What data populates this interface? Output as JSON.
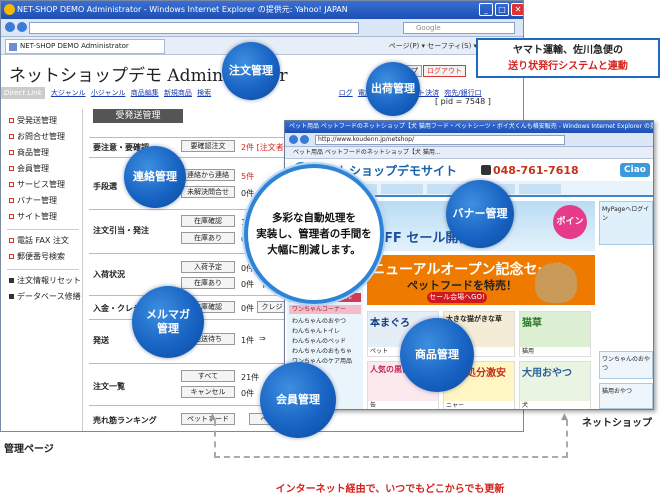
{
  "admin_window": {
    "title": "NET-SHOP DEMO Administrator - Windows Internet Explorer の提供元: Yahoo! JAPAN",
    "search_placeholder": "Google",
    "tab_label": "NET-SHOP DEMO Administrator",
    "command_bar": "ページ(P) ▾  セーフティ(S) ▾  ツール(O) ▾",
    "min": "_",
    "max": "□",
    "close": "✕",
    "site_title": "ネットショップデモ Administrator",
    "head_buttons": [
      "トップ",
      "ログアウト"
    ],
    "direct_link": "Direct Link",
    "nav_links": [
      "大ジャンル",
      "小ジャンル",
      "商品編集",
      "新規商品",
      "検索"
    ],
    "nav_links_right": [
      "ログ",
      "電話FAX受付",
      "ネット決済",
      "宛先/銀行口"
    ],
    "pid": "[ pid = 7548 ]",
    "sidebar": [
      "受発送管理",
      "お問合せ管理",
      "商品管理",
      "会員管理",
      "サービス管理",
      "バナー管理",
      "サイト管理",
      "電話 FAX 注文",
      "郵便番号検索",
      "注文情報リセット",
      "データベース修繕"
    ],
    "content_header": "受発送管理",
    "rows": {
      "r1_label": "要注意・要確認",
      "r1_btn": "要確認注文",
      "r1_count": "2件 [注文者",
      "r2_label": "手段選",
      "r2_btn1": "連絡から連絡",
      "r2_count": "5件",
      "r2_btn2": "未解決問合せ",
      "r2_count2": "0件",
      "r3_label": "注文引当・発注",
      "r3_btn1": "在庫確認",
      "r3_count1": "1 件",
      "r3_btn2": "在庫あり",
      "r3_count2": "0件",
      "r4_label": "入荷状況",
      "r4_btn1": "入荷予定",
      "r4_count1": "0件",
      "r4_btn2": "在庫あり",
      "r4_count2": "0件　商品 1",
      "r5_label": "入金・クレジット",
      "r5_btn1": "在庫確認",
      "r5_count1": "0件",
      "r5_btn3": "クレジ",
      "r6_label": "発送",
      "r6_btn": "発送待ち",
      "r6_count": "1件",
      "r6_arrow": "⇒",
      "r7_label": "注文一覧",
      "r7_btn1": "すべて",
      "r7_count1": "21件",
      "r7_btn2": "キャンセル",
      "r7_count2": "0件",
      "r8_label": "売れ筋ランキング",
      "r8_btn1": "ペットフード",
      "r8_btn2": "ペ"
    }
  },
  "shop_window": {
    "title": "ペット用品 ペットフードのネットショップ【犬 猫用フード・ペットシーツ・ボイ犬くんも格安販売 - Windows Internet Explorer の提供元: Yahoo! JAPAN",
    "address": "http://www.koudenn.jp/netshop/",
    "tab": "ペット用品 ペットフードのネットショップ【犬 猫用...",
    "shop_name": "ネットショップデモサイト",
    "tel": "048-761-7618",
    "logo_badge": "Ciao",
    "left_menu": [
      "ワンちゃんネコちゃん",
      "ワンちゃんコーナー",
      "わんちゃんのおやつ",
      "わんちゃんトイレ",
      "わんちゃんのベッド",
      "わんちゃんのおもちゃ",
      "ワンちゃんのケア用品"
    ],
    "banner_top_text": "OFF セール開催中！",
    "banner_badge": "ポイント2倍",
    "banner_main_title": "ニューアルオープン記念セール",
    "banner_main_sub": "ペットフードを特売！",
    "banner_main_pill": "セール会場へGO!",
    "products": [
      "本まぐろ",
      "大きな猫がきな草",
      "猫草",
      "人気の黒缶セール",
      "在庫処分激安",
      "大用おやつ"
    ],
    "right_boxes": [
      "MyPageへログイン",
      "ワンちゃんのおやつ",
      "猫用おやつ"
    ]
  },
  "callouts": {
    "chumon": "注文管理",
    "shukka": "出荷管理",
    "renraku": "連絡管理",
    "banner": "バナー管理",
    "melmaga": "メルマガ\n管理",
    "shohin": "商品管理",
    "kaiin": "会員管理",
    "center": "多彩な自動処理を\n実装し、管理者の手間を\n大幅に削減します。",
    "yamato_line1": "ヤマト運輸、佐川急便の",
    "yamato_line2": "送り状発行システムと連動"
  },
  "captions": {
    "admin": "管理ページ",
    "shop": "ネットショップ",
    "bottom": "インターネット経由で、いつでもどこからでも更新"
  },
  "colors": {
    "accent_blue": "#1863c3",
    "caption_red": "#d2231c",
    "ie_title": "#1c4fb3"
  }
}
